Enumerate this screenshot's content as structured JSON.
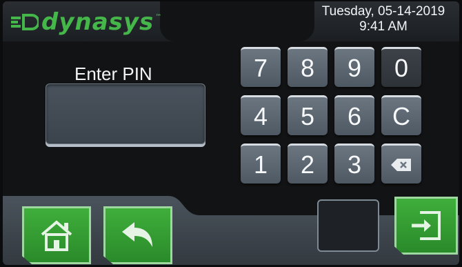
{
  "header": {
    "brand": "dynasys",
    "date": "Tuesday, 05-14-2019",
    "time": "9:41 AM"
  },
  "pin": {
    "label": "Enter PIN",
    "value": ""
  },
  "keypad": {
    "keys": [
      "7",
      "8",
      "9",
      "0",
      "4",
      "5",
      "6",
      "C",
      "1",
      "2",
      "3"
    ],
    "backspace_icon": "backspace-icon"
  },
  "footer": {
    "home_icon": "home-icon",
    "back_icon": "back-arrow-icon",
    "enter_icon": "enter-icon"
  },
  "colors": {
    "accent_green": "#3fae3b",
    "key_gray": "#5d6872"
  }
}
